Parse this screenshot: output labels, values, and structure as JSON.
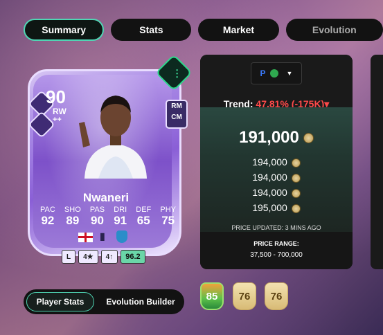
{
  "tabs": [
    {
      "label": "Summary"
    },
    {
      "label": "Stats"
    },
    {
      "label": "Market"
    },
    {
      "label": "Evolution"
    }
  ],
  "card": {
    "rating": "90",
    "position": "RW",
    "plus": "++",
    "alt_positions": [
      "RM",
      "CM"
    ],
    "name": "Nwaneri",
    "stats": [
      {
        "label": "PAC",
        "value": "92"
      },
      {
        "label": "SHO",
        "value": "89"
      },
      {
        "label": "PAS",
        "value": "90"
      },
      {
        "label": "DRI",
        "value": "91"
      },
      {
        "label": "DEF",
        "value": "65"
      },
      {
        "label": "PHY",
        "value": "75"
      }
    ],
    "foot": "L",
    "skill_moves": "4★",
    "weak_foot": "4↑",
    "chem_rating": "96.2"
  },
  "market": {
    "platform_icons": [
      "playstation-icon",
      "xbox-icon"
    ],
    "trend_label": "Trend:",
    "trend_value": "47.81% (-175K)",
    "trend_color": "#ff4a4a",
    "main_price": "191,000",
    "prices": [
      "194,000",
      "194,000",
      "194,000",
      "195,000"
    ],
    "updated": "PRICE UPDATED: 3 MINS AGO",
    "range_title": "PRICE RANGE:",
    "range_value": "37,500 - 700,000"
  },
  "bottom": {
    "toggle_on": "Player Stats",
    "toggle_off": "Evolution Builder",
    "mini_cards": [
      "85",
      "76",
      "76"
    ]
  },
  "colors": {
    "accent": "#4fd6b4",
    "panel": "#1a1a1a"
  }
}
